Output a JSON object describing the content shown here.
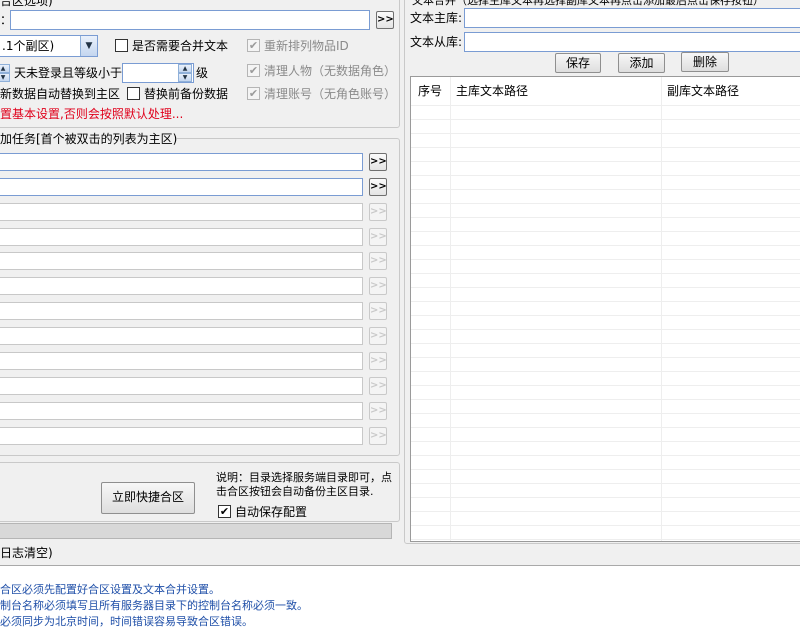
{
  "left_settings": {
    "group_title": "合区选项)",
    "main_path_label": "：",
    "main_path_value": "",
    "combo_value": ".1个副区)",
    "merge_text_checkbox": "是否需要合并文本",
    "merge_text_checked": false,
    "reorder_items_checkbox": "重新排列物品ID",
    "reorder_items_checked": true,
    "days_label": "天未登录且等级小于",
    "level_value": "",
    "level_suffix": "级",
    "clean_chars_checkbox": "清理人物（无数据角色）",
    "clean_chars_checked": true,
    "auto_replace_label": "新数据自动替换到主区",
    "backup_checkbox": "替换前备份数据",
    "backup_checked": false,
    "clean_accounts_checkbox": "清理账号（无角色账号）",
    "clean_accounts_checked": true,
    "warning_text": "置基本设置,否则会按照默认处理..."
  },
  "task_list": {
    "title": "加任务[首个被双击的列表为主区)",
    "rows": [
      {
        "value": "",
        "enabled": true
      },
      {
        "value": "",
        "enabled": true
      },
      {
        "value": "",
        "enabled": false
      },
      {
        "value": "",
        "enabled": false
      },
      {
        "value": "",
        "enabled": false
      },
      {
        "value": "",
        "enabled": false
      },
      {
        "value": "",
        "enabled": false
      },
      {
        "value": "",
        "enabled": false
      },
      {
        "value": "",
        "enabled": false
      },
      {
        "value": "",
        "enabled": false
      },
      {
        "value": "",
        "enabled": false
      },
      {
        "value": "",
        "enabled": false
      }
    ],
    "browse_label": ">>"
  },
  "action_panel": {
    "merge_button": "立即快捷合区",
    "note_text_line1": "说明：目录选择服务端目录即可，点",
    "note_text_line2": "击合区按钮会自动备份主区目录.",
    "auto_save_checkbox": "自动保存配置",
    "auto_save_checked": true
  },
  "text_merge": {
    "header_text": "文本合并（选择主库文本再选择副库文本再点击添加最后点击保存按钮）",
    "main_lib_label": "文本主库:",
    "main_lib_value": "",
    "sub_lib_label": "文本从库:",
    "sub_lib_value": "",
    "save_button": "保存",
    "add_button": "添加",
    "delete_button": "删除",
    "columns": [
      "序号",
      "主库文本路径",
      "副库文本路径"
    ]
  },
  "log": {
    "title": "日志清空)",
    "lines": [
      "合区必须先配置好合区设置及文本合并设置。",
      "制台名称必须填写且所有服务器目录下的控制台名称必须一致。",
      "必须同步为北京时间，时间错误容易导致合区错误。"
    ]
  },
  "glyphs": {
    "check": "✔",
    "combo_arrow": "▼",
    "spin_up": "▲",
    "spin_down": "▼"
  }
}
